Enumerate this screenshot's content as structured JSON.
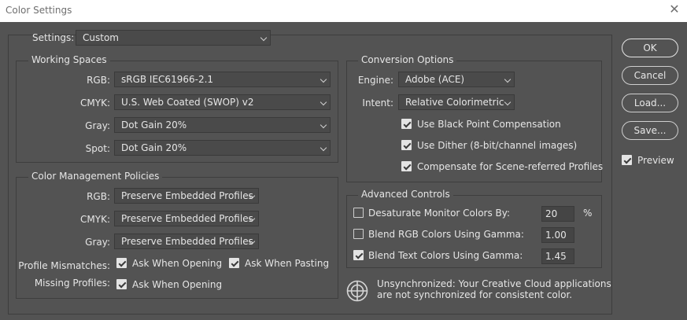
{
  "window": {
    "title": "Color Settings"
  },
  "settings": {
    "label": "Settings:",
    "value": "Custom"
  },
  "working_spaces": {
    "title": "Working Spaces",
    "rows": [
      {
        "label": "RGB:",
        "value": "sRGB IEC61966-2.1"
      },
      {
        "label": "CMYK:",
        "value": "U.S. Web Coated (SWOP) v2"
      },
      {
        "label": "Gray:",
        "value": "Dot Gain 20%"
      },
      {
        "label": "Spot:",
        "value": "Dot Gain 20%"
      }
    ]
  },
  "policies": {
    "title": "Color Management Policies",
    "rows": [
      {
        "label": "RGB:",
        "value": "Preserve Embedded Profiles"
      },
      {
        "label": "CMYK:",
        "value": "Preserve Embedded Profiles"
      },
      {
        "label": "Gray:",
        "value": "Preserve Embedded Profiles"
      }
    ],
    "profile_mismatches": {
      "label": "Profile Mismatches:",
      "ask_opening": "Ask When Opening",
      "ask_pasting": "Ask When Pasting"
    },
    "missing_profiles": {
      "label": "Missing Profiles:",
      "ask_opening": "Ask When Opening"
    }
  },
  "conversion": {
    "title": "Conversion Options",
    "engine": {
      "label": "Engine:",
      "value": "Adobe (ACE)"
    },
    "intent": {
      "label": "Intent:",
      "value": "Relative Colorimetric"
    },
    "black_point": "Use Black Point Compensation",
    "dither": "Use Dither (8-bit/channel images)",
    "compensate": "Compensate for Scene-referred Profiles"
  },
  "advanced": {
    "title": "Advanced Controls",
    "desaturate": {
      "label": "Desaturate Monitor Colors By:",
      "value": "20",
      "unit": "%"
    },
    "blend_rgb": {
      "label": "Blend RGB Colors Using Gamma:",
      "value": "1.00"
    },
    "blend_text": {
      "label": "Blend Text Colors Using Gamma:",
      "value": "1.45"
    }
  },
  "sync": {
    "line1": "Unsynchronized: Your Creative Cloud applications",
    "line2": "are not synchronized for consistent color."
  },
  "buttons": {
    "ok": "OK",
    "cancel": "Cancel",
    "load": "Load...",
    "save": "Save...",
    "preview": "Preview"
  }
}
